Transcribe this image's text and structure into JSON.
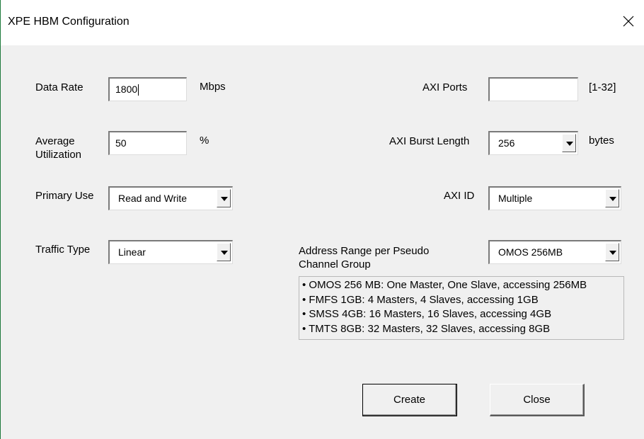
{
  "window": {
    "title": "XPE HBM Configuration"
  },
  "fields": {
    "data_rate": {
      "label": "Data Rate",
      "value": "1800",
      "unit": "Mbps"
    },
    "average_utilization": {
      "label_line1": "Average",
      "label_line2": "Utilization",
      "value": "50",
      "unit": "%"
    },
    "primary_use": {
      "label": "Primary Use",
      "value": "Read and Write"
    },
    "traffic_type": {
      "label": "Traffic Type",
      "value": "Linear"
    },
    "axi_ports": {
      "label": "AXI Ports",
      "value": "",
      "range": "[1-32]"
    },
    "axi_burst_length": {
      "label": "AXI Burst Length",
      "value": "256",
      "unit": "bytes"
    },
    "axi_id": {
      "label": "AXI ID",
      "value": "Multiple"
    },
    "address_range": {
      "label_line1": "Address Range per Pseudo",
      "label_line2": "Channel Group",
      "value": "OMOS 256MB"
    }
  },
  "info_lines": [
    "• OMOS 256 MB: One Master, One Slave, accessing 256MB",
    "• FMFS 1GB: 4 Masters, 4 Slaves, accessing 1GB",
    "• SMSS 4GB: 16 Masters, 16 Slaves, accessing 4GB",
    "• TMTS 8GB: 32 Masters, 32 Slaves, accessing 8GB"
  ],
  "buttons": {
    "create": "Create",
    "close": "Close"
  },
  "icons": {
    "close": "close-icon",
    "dropdown": "chevron-down-icon"
  }
}
